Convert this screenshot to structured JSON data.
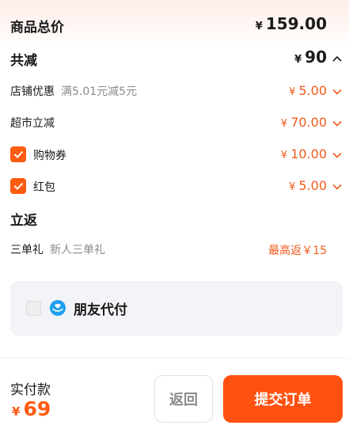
{
  "summary": {
    "total_label": "商品总价",
    "total_currency": "¥",
    "total_value": "159.00",
    "discount_label": "共减",
    "discount_currency": "¥",
    "discount_value": "90"
  },
  "discounts": [
    {
      "label": "店铺优惠",
      "sub": "满5.01元减5元",
      "currency": "¥",
      "value": "5.00"
    },
    {
      "label": "超市立减",
      "sub": "",
      "currency": "¥",
      "value": "70.00"
    },
    {
      "label": "购物券",
      "sub": "",
      "currency": "¥",
      "value": "10.00",
      "checked": true
    },
    {
      "label": "红包",
      "sub": "",
      "currency": "¥",
      "value": "5.00",
      "checked": true
    }
  ],
  "rebate": {
    "title": "立返",
    "label": "三单礼",
    "sub": "新人三单礼",
    "value_text": "最高返￥15"
  },
  "friend_pay": {
    "label": "朋友代付",
    "checked": false
  },
  "footer": {
    "pay_label": "实付款",
    "pay_currency": "¥",
    "pay_value": "69",
    "back_label": "返回",
    "submit_label": "提交订单"
  },
  "colors": {
    "accent": "#ff5210",
    "discount_text": "#f25a1b",
    "friend_icon": "#1ea0f2",
    "card_bg": "#f3f4f7"
  },
  "icons": [
    "chevron-up-icon",
    "chevron-down-icon",
    "checkbox-checked-icon",
    "friend-pay-icon"
  ]
}
